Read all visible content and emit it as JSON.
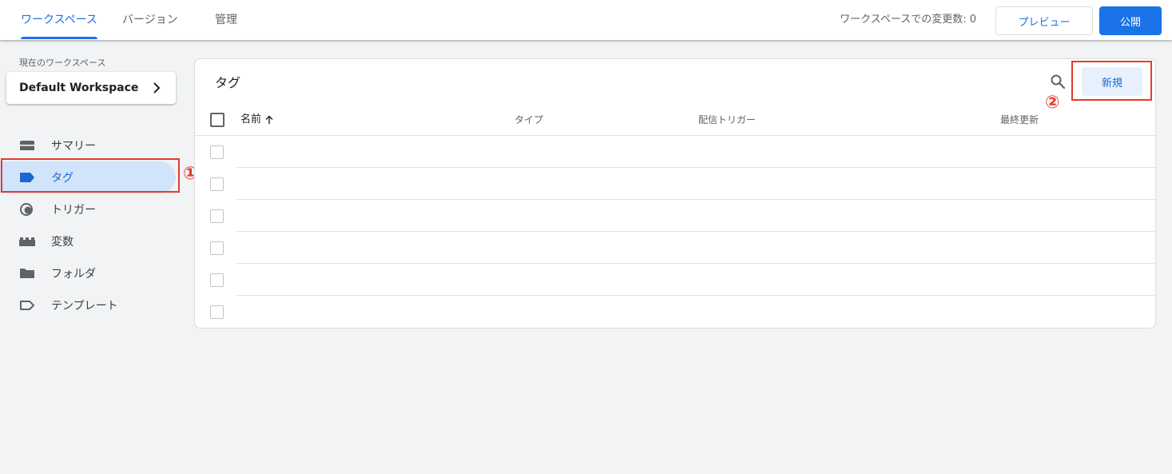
{
  "header": {
    "tabs": [
      {
        "label": "ワークスペース",
        "active": true
      },
      {
        "label": "バージョン",
        "active": false
      },
      {
        "label": "管理",
        "active": false
      }
    ],
    "changes_text": "ワークスペースでの変更数: 0",
    "preview_label": "プレビュー",
    "publish_label": "公開"
  },
  "sidebar": {
    "workspace_label": "現在のワークスペース",
    "workspace_name": "Default Workspace",
    "items": [
      {
        "label": "サマリー",
        "icon": "summary-icon"
      },
      {
        "label": "タグ",
        "icon": "tag-icon",
        "active": true
      },
      {
        "label": "トリガー",
        "icon": "trigger-icon"
      },
      {
        "label": "変数",
        "icon": "variables-icon"
      },
      {
        "label": "フォルダ",
        "icon": "folder-icon"
      },
      {
        "label": "テンプレート",
        "icon": "template-icon"
      }
    ]
  },
  "tags_panel": {
    "title": "タグ",
    "new_label": "新規",
    "columns": [
      "名前",
      "タイプ",
      "配信トリガー",
      "最終更新"
    ]
  },
  "annotations": {
    "marker_1": "①",
    "marker_2": "②",
    "color": "#e53b2c"
  },
  "colors": {
    "accent": "#1a73e8",
    "active_nav_bg": "#d2e3fc"
  }
}
